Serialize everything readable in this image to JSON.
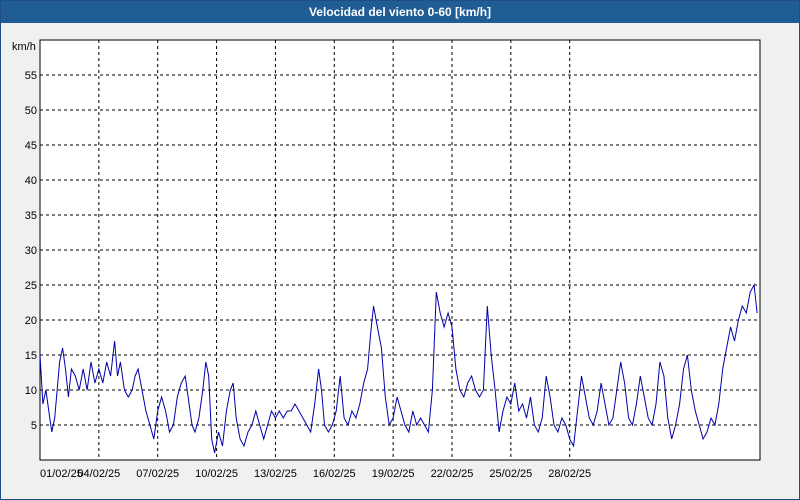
{
  "window": {
    "title": "Velocidad del viento 0-60 [km/h]"
  },
  "chart_data": {
    "type": "line",
    "title": "Velocidad del viento 0-60 [km/h]",
    "ylabel": "km/h",
    "xlabel": "",
    "ylim": [
      0,
      60
    ],
    "y_ticks": [
      5,
      10,
      15,
      20,
      25,
      30,
      35,
      40,
      45,
      50,
      55
    ],
    "x_range": [
      "2025-02-01",
      "2025-03-01"
    ],
    "x_ticks": [
      "01/02/25",
      "04/02/25",
      "07/02/25",
      "10/02/25",
      "13/02/25",
      "16/02/25",
      "19/02/25",
      "22/02/25",
      "25/02/25",
      "28/02/25"
    ],
    "grid": true,
    "colors": {
      "line": "#0000aa",
      "grid": "#000000",
      "plot_bg": "#ffffff",
      "frame_bg": "#f0f0f0",
      "title_bg": "#1f5d94"
    },
    "series": [
      {
        "values": [
          [
            0,
            15
          ],
          [
            0.15,
            8
          ],
          [
            0.3,
            10
          ],
          [
            0.45,
            7
          ],
          [
            0.6,
            4
          ],
          [
            0.75,
            6
          ],
          [
            1.0,
            14
          ],
          [
            1.15,
            16
          ],
          [
            1.3,
            13
          ],
          [
            1.45,
            9
          ],
          [
            1.6,
            13
          ],
          [
            1.8,
            12
          ],
          [
            2.0,
            10
          ],
          [
            2.2,
            13
          ],
          [
            2.4,
            10
          ],
          [
            2.6,
            14
          ],
          [
            2.8,
            11
          ],
          [
            3.0,
            13
          ],
          [
            3.2,
            11
          ],
          [
            3.4,
            14
          ],
          [
            3.6,
            12
          ],
          [
            3.8,
            17
          ],
          [
            3.95,
            12
          ],
          [
            4.1,
            14
          ],
          [
            4.3,
            10
          ],
          [
            4.5,
            9
          ],
          [
            4.7,
            10
          ],
          [
            4.85,
            12
          ],
          [
            5.0,
            13
          ],
          [
            5.2,
            10
          ],
          [
            5.4,
            7
          ],
          [
            5.6,
            5
          ],
          [
            5.8,
            3
          ],
          [
            6.0,
            7
          ],
          [
            6.2,
            9
          ],
          [
            6.4,
            7
          ],
          [
            6.6,
            4
          ],
          [
            6.8,
            5
          ],
          [
            7.0,
            9
          ],
          [
            7.2,
            11
          ],
          [
            7.4,
            12
          ],
          [
            7.6,
            8
          ],
          [
            7.75,
            5
          ],
          [
            7.9,
            4
          ],
          [
            8.1,
            6
          ],
          [
            8.3,
            10
          ],
          [
            8.45,
            14
          ],
          [
            8.6,
            12
          ],
          [
            8.75,
            3
          ],
          [
            8.9,
            1
          ],
          [
            9.1,
            4
          ],
          [
            9.3,
            2
          ],
          [
            9.5,
            7
          ],
          [
            9.7,
            10
          ],
          [
            9.85,
            11
          ],
          [
            10.0,
            6
          ],
          [
            10.2,
            3
          ],
          [
            10.4,
            2
          ],
          [
            10.6,
            4
          ],
          [
            10.8,
            5
          ],
          [
            11.0,
            7
          ],
          [
            11.2,
            5
          ],
          [
            11.4,
            3
          ],
          [
            11.6,
            5
          ],
          [
            11.8,
            7
          ],
          [
            12.0,
            6
          ],
          [
            12.2,
            7
          ],
          [
            12.4,
            6
          ],
          [
            12.6,
            7
          ],
          [
            12.8,
            7
          ],
          [
            13.0,
            8
          ],
          [
            13.2,
            7
          ],
          [
            13.4,
            6
          ],
          [
            13.6,
            5
          ],
          [
            13.8,
            4
          ],
          [
            14.0,
            8
          ],
          [
            14.2,
            13
          ],
          [
            14.35,
            10
          ],
          [
            14.5,
            5
          ],
          [
            14.7,
            4
          ],
          [
            14.9,
            5
          ],
          [
            15.1,
            7
          ],
          [
            15.3,
            12
          ],
          [
            15.5,
            6
          ],
          [
            15.7,
            5
          ],
          [
            15.9,
            7
          ],
          [
            16.1,
            6
          ],
          [
            16.3,
            8
          ],
          [
            16.5,
            11
          ],
          [
            16.7,
            13
          ],
          [
            16.85,
            18
          ],
          [
            17.0,
            22
          ],
          [
            17.2,
            19
          ],
          [
            17.4,
            16
          ],
          [
            17.6,
            9
          ],
          [
            17.8,
            5
          ],
          [
            18.0,
            6
          ],
          [
            18.2,
            9
          ],
          [
            18.4,
            7
          ],
          [
            18.6,
            5
          ],
          [
            18.8,
            4
          ],
          [
            19.0,
            7
          ],
          [
            19.2,
            5
          ],
          [
            19.4,
            6
          ],
          [
            19.6,
            5
          ],
          [
            19.8,
            4
          ],
          [
            20.0,
            10
          ],
          [
            20.2,
            24
          ],
          [
            20.4,
            21
          ],
          [
            20.6,
            19
          ],
          [
            20.8,
            21
          ],
          [
            21.0,
            19
          ],
          [
            21.2,
            13
          ],
          [
            21.4,
            10
          ],
          [
            21.6,
            9
          ],
          [
            21.8,
            11
          ],
          [
            22.0,
            12
          ],
          [
            22.2,
            10
          ],
          [
            22.4,
            9
          ],
          [
            22.6,
            10
          ],
          [
            22.8,
            22
          ],
          [
            23.0,
            15
          ],
          [
            23.2,
            10
          ],
          [
            23.4,
            4
          ],
          [
            23.6,
            7
          ],
          [
            23.8,
            9
          ],
          [
            24.0,
            8
          ],
          [
            24.2,
            11
          ],
          [
            24.4,
            7
          ],
          [
            24.6,
            8
          ],
          [
            24.8,
            6
          ],
          [
            25.0,
            9
          ],
          [
            25.2,
            5
          ],
          [
            25.4,
            4
          ],
          [
            25.6,
            6
          ],
          [
            25.8,
            12
          ],
          [
            26.0,
            9
          ],
          [
            26.2,
            5
          ],
          [
            26.4,
            4
          ],
          [
            26.6,
            6
          ],
          [
            26.8,
            5
          ],
          [
            27.0,
            3
          ],
          [
            27.2,
            2
          ],
          [
            27.4,
            7
          ],
          [
            27.6,
            12
          ],
          [
            27.8,
            9
          ],
          [
            28.0,
            6
          ],
          [
            28.2,
            5
          ],
          [
            28.4,
            7
          ],
          [
            28.6,
            11
          ],
          [
            28.8,
            8
          ],
          [
            29.0,
            5
          ],
          [
            29.2,
            6
          ],
          [
            29.4,
            10
          ],
          [
            29.6,
            14
          ],
          [
            29.8,
            11
          ],
          [
            30.0,
            6
          ],
          [
            30.2,
            5
          ],
          [
            30.4,
            8
          ],
          [
            30.6,
            12
          ],
          [
            30.8,
            9
          ],
          [
            31.0,
            6
          ],
          [
            31.2,
            5
          ],
          [
            31.4,
            8
          ],
          [
            31.6,
            14
          ],
          [
            31.8,
            12
          ],
          [
            32.0,
            6
          ],
          [
            32.2,
            3
          ],
          [
            32.4,
            5
          ],
          [
            32.6,
            8
          ],
          [
            32.8,
            13
          ],
          [
            33.0,
            15
          ],
          [
            33.2,
            10
          ],
          [
            33.4,
            7
          ],
          [
            33.6,
            5
          ],
          [
            33.8,
            3
          ],
          [
            34.0,
            4
          ],
          [
            34.2,
            6
          ],
          [
            34.4,
            5
          ],
          [
            34.6,
            8
          ],
          [
            34.8,
            13
          ],
          [
            35.0,
            16
          ],
          [
            35.2,
            19
          ],
          [
            35.4,
            17
          ],
          [
            35.6,
            20
          ],
          [
            35.8,
            22
          ],
          [
            36.0,
            21
          ],
          [
            36.2,
            24
          ],
          [
            36.4,
            25
          ],
          [
            36.55,
            21
          ]
        ]
      }
    ]
  }
}
